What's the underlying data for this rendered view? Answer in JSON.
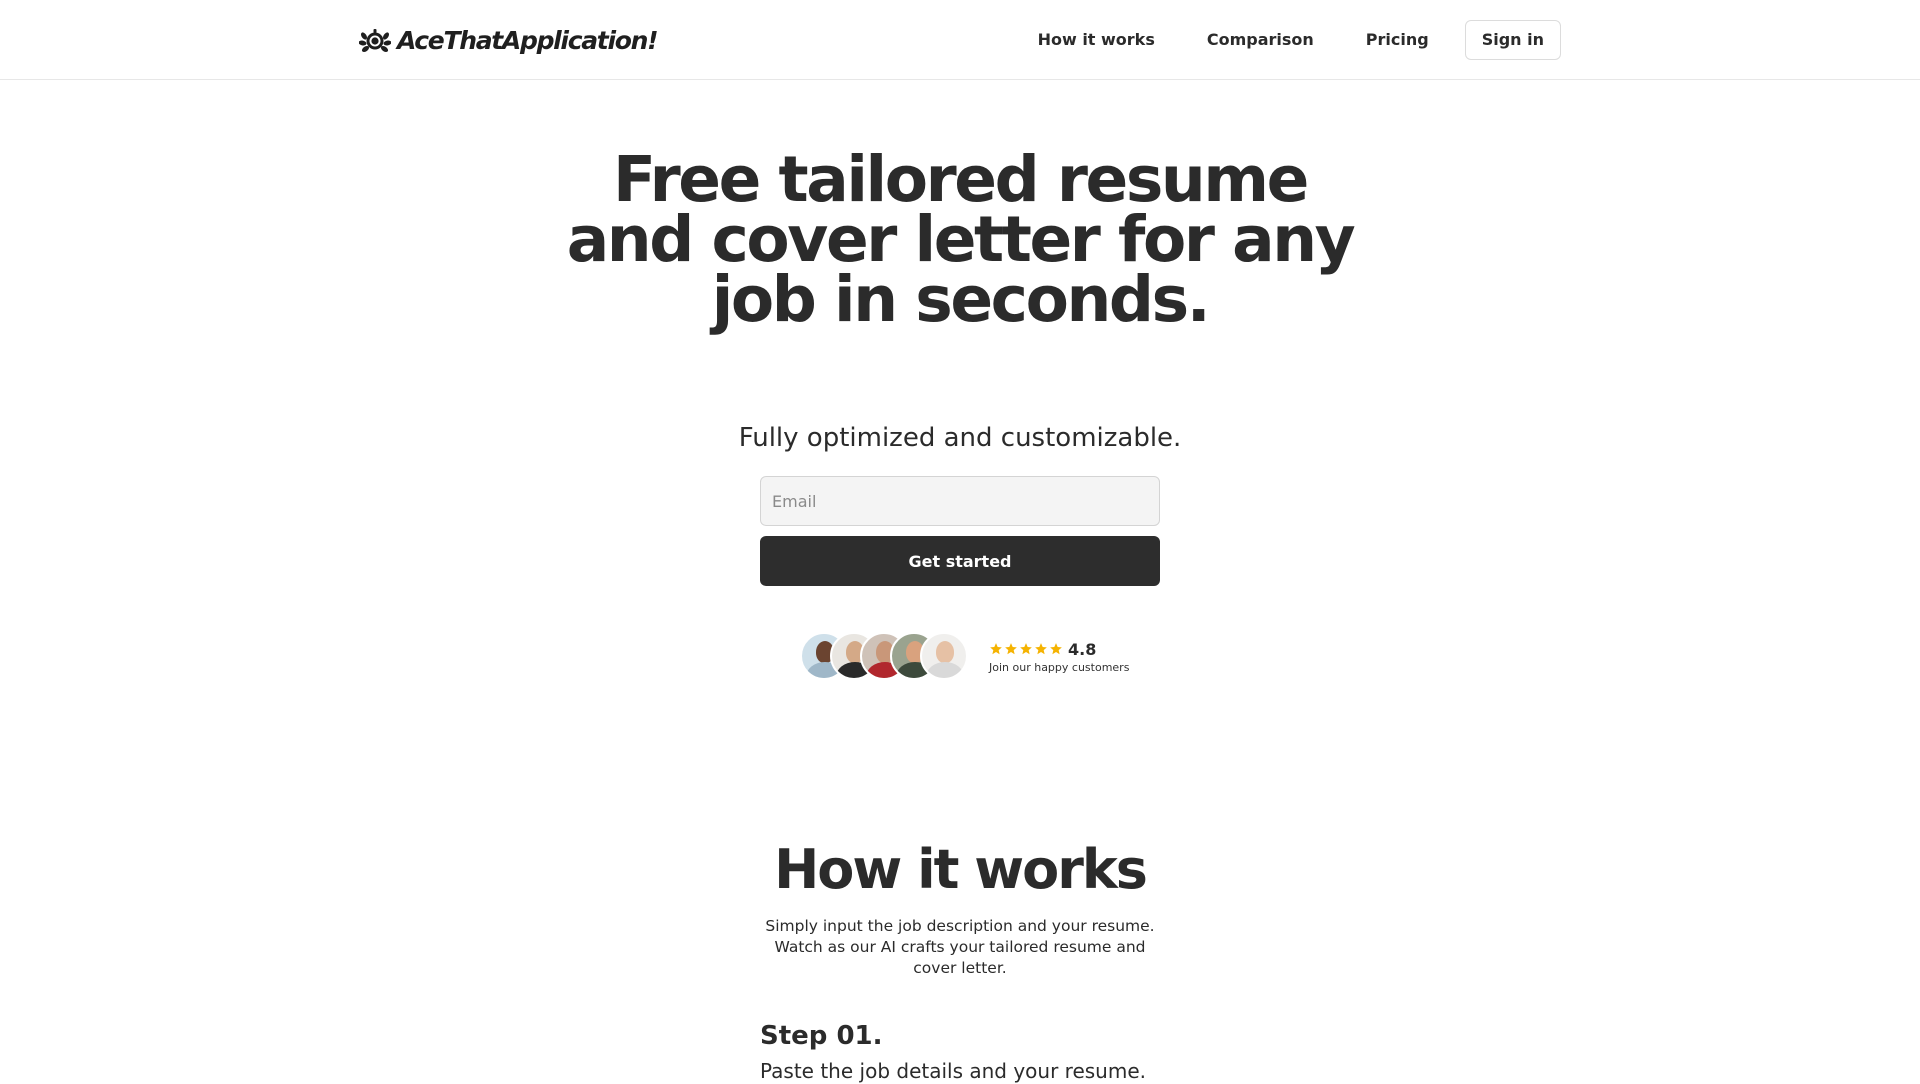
{
  "header": {
    "brand_name": "AceThatApplication!",
    "brand_icon": "laurel-lion-icon",
    "nav": [
      {
        "label": "How it works"
      },
      {
        "label": "Comparison"
      },
      {
        "label": "Pricing"
      }
    ],
    "signin_label": "Sign in"
  },
  "hero": {
    "title": "Free tailored resume and cover letter for any job in seconds.",
    "subtitle": "Fully optimized and customizable.",
    "email_placeholder": "Email",
    "email_value": "",
    "cta_label": "Get started"
  },
  "social_proof": {
    "avatar_count": 5,
    "star_count": 5,
    "star_color": "#f5b301",
    "rating": "4.8",
    "caption": "Join our happy customers"
  },
  "how_it_works": {
    "title": "How it works",
    "description": "Simply input the job description and your resume. Watch as our AI crafts your tailored resume and cover letter.",
    "steps": [
      {
        "title": "Step 01.",
        "description": "Paste the job details and your resume."
      }
    ]
  },
  "colors": {
    "text": "#2b2b2b",
    "cta_background": "#2d2d2d",
    "cta_text": "#ffffff",
    "input_background": "#f4f4f4",
    "border": "#e7e7e7"
  }
}
